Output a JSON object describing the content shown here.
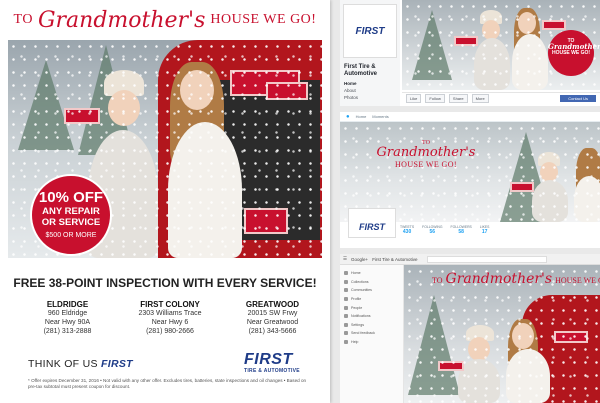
{
  "flyer": {
    "headline_pre": "TO",
    "headline_script": "Grandmother's",
    "headline_post": "HOUSE WE GO!",
    "offer": {
      "big": "10% OFF",
      "line1": "ANY REPAIR",
      "line2": "OR SERVICE",
      "small": "$500 OR MORE"
    },
    "inspection": "FREE 38-POINT INSPECTION WITH EVERY SERVICE!",
    "locations": [
      {
        "name": "ELDRIDGE",
        "address": "960 Eldridge",
        "near": "Near Hwy 90A",
        "phone": "(281) 313-2888"
      },
      {
        "name": "FIRST COLONY",
        "address": "2303 Williams Trace",
        "near": "Near Hwy 6",
        "phone": "(281) 980-2666"
      },
      {
        "name": "GREATWOOD",
        "address": "20015 SW Frwy",
        "near": "Near Greatwood",
        "phone": "(281) 343-5666"
      }
    ],
    "tagline_pre": "THINK OF US",
    "tagline_first": "FIRST",
    "logo_first": "FIRST",
    "logo_sub": "TIRE & AUTOMOTIVE",
    "disclaimer": "* Offer expires December 31, 2016 • Not valid with any other offer. Excludes tires, batteries, state inspections and oil changes • Based on pre-tax subtotal must present coupon for discount."
  },
  "facebook": {
    "logo_first": "FIRST",
    "page_title": "First Tire & Automotive",
    "menu": [
      "Home",
      "About",
      "Photos"
    ],
    "cover_badge_pre": "TO",
    "cover_badge_script": "Grandmother's",
    "cover_badge_post": "HOUSE WE GO!",
    "actions": [
      "Like",
      "Follow",
      "Share",
      "More"
    ],
    "contact_label": "Contact Us"
  },
  "twitter": {
    "nav": [
      "Home",
      "Moments"
    ],
    "title_pre": "TO",
    "title_script": "Grandmother's",
    "title_post": "HOUSE WE GO!",
    "logo_first": "FIRST",
    "stats": [
      {
        "label": "TWEETS",
        "value": "430"
      },
      {
        "label": "FOLLOWING",
        "value": "56"
      },
      {
        "label": "FOLLOWERS",
        "value": "58"
      },
      {
        "label": "LIKES",
        "value": "17"
      }
    ]
  },
  "googleplus": {
    "brand": "Google+",
    "page_name": "First Tire & Automotive",
    "menu": [
      "Home",
      "Collections",
      "Communities",
      "Profile",
      "People",
      "Notifications",
      "Settings",
      "Send feedback",
      "Help"
    ],
    "title_pre": "TO",
    "title_script": "Grandmother's",
    "title_post": "HOUSE WE GO!"
  },
  "colors": {
    "brand_red": "#c8102e",
    "brand_blue": "#1f3c88",
    "facebook_blue": "#4267b2",
    "twitter_blue": "#1da1f2"
  }
}
